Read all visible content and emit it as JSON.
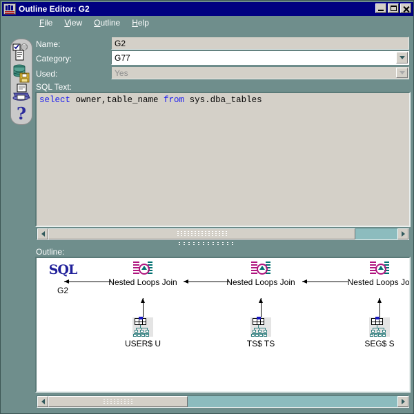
{
  "window": {
    "title": "Outline Editor: G2",
    "icon": "oracle-app-icon",
    "buttons": {
      "minimize": "Minimize",
      "maximize": "Maximize",
      "close": "Close"
    }
  },
  "menu": {
    "items": [
      {
        "label": "File",
        "accel": "F"
      },
      {
        "label": "View",
        "accel": "V"
      },
      {
        "label": "Outline",
        "accel": "O"
      },
      {
        "label": "Help",
        "accel": "H"
      }
    ]
  },
  "toolbar": {
    "buttons": [
      {
        "name": "edit-sql-icon",
        "tooltip": "Edit"
      },
      {
        "name": "save-to-database-icon",
        "tooltip": "Save"
      },
      {
        "name": "print-icon",
        "tooltip": "Print"
      },
      {
        "name": "help-icon",
        "tooltip": "Help"
      }
    ]
  },
  "form": {
    "name": {
      "label": "Name:",
      "value": "G2",
      "enabled": false
    },
    "category": {
      "label": "Category:",
      "value": "G77",
      "enabled": true
    },
    "used": {
      "label": "Used:",
      "value": "Yes",
      "enabled": false
    },
    "sql": {
      "label": "SQL Text:",
      "tokens": [
        {
          "text": "select",
          "kind": "keyword"
        },
        {
          "text": " owner,table_name ",
          "kind": "plain"
        },
        {
          "text": "from",
          "kind": "keyword"
        },
        {
          "text": " sys.dba_tables",
          "kind": "plain"
        }
      ],
      "value": "select owner,table_name from sys.dba_tables"
    }
  },
  "outline": {
    "label": "Outline:",
    "nodes": [
      {
        "id": "sql-root",
        "glyph": "SQL",
        "caption": "G2",
        "icon": "sql-statement-icon"
      },
      {
        "id": "join-1",
        "glyph": "",
        "caption": "Nested Loops Join",
        "icon": "nested-loops-join-icon"
      },
      {
        "id": "join-2",
        "glyph": "",
        "caption": "Nested Loops Join",
        "icon": "nested-loops-join-icon"
      },
      {
        "id": "join-3",
        "glyph": "",
        "caption": "Nested Loops Joi",
        "icon": "nested-loops-join-icon"
      }
    ],
    "leaves": [
      {
        "id": "tbl-1",
        "caption": "USER$ U",
        "icon": "table-access-icon"
      },
      {
        "id": "tbl-2",
        "caption": "TS$ TS",
        "icon": "table-access-icon"
      },
      {
        "id": "tbl-3",
        "caption": "SEG$ S",
        "icon": "table-access-icon"
      }
    ]
  },
  "scrollbars": {
    "sql": {
      "left_arrow": "◄",
      "right_arrow": "►"
    },
    "outline": {
      "left_arrow": "◄",
      "right_arrow": "►"
    }
  },
  "colors": {
    "window_background": "#6f8e8c",
    "titlebar": "#000080",
    "titlebar_text": "#ffffff",
    "field_disabled": "#d4d0c8",
    "field_enabled": "#ffffff",
    "sql_keyword": "#1a1af0",
    "sql_text": "#000000",
    "canvas": "#ffffff",
    "sql_node": "#20209a",
    "scrollbar_track": "#8cbcbe",
    "join_icon_left": "#b0157f",
    "join_icon_right": "#007070"
  }
}
